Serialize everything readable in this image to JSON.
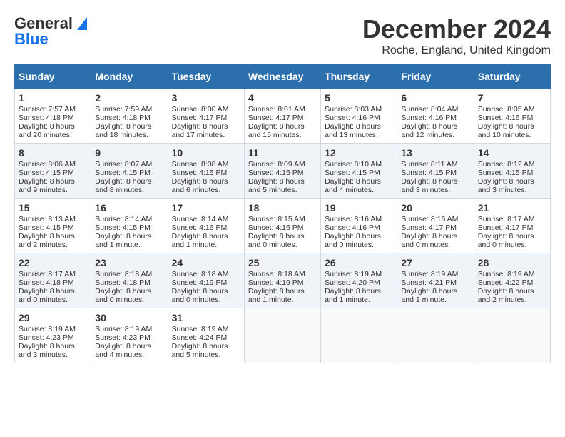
{
  "header": {
    "logo_line1": "General",
    "logo_line2": "Blue",
    "title": "December 2024",
    "subtitle": "Roche, England, United Kingdom"
  },
  "days_of_week": [
    "Sunday",
    "Monday",
    "Tuesday",
    "Wednesday",
    "Thursday",
    "Friday",
    "Saturday"
  ],
  "weeks": [
    [
      {
        "day": 1,
        "sunrise": "7:57 AM",
        "sunset": "4:18 PM",
        "daylight": "8 hours and 20 minutes."
      },
      {
        "day": 2,
        "sunrise": "7:59 AM",
        "sunset": "4:18 PM",
        "daylight": "8 hours and 18 minutes."
      },
      {
        "day": 3,
        "sunrise": "8:00 AM",
        "sunset": "4:17 PM",
        "daylight": "8 hours and 17 minutes."
      },
      {
        "day": 4,
        "sunrise": "8:01 AM",
        "sunset": "4:17 PM",
        "daylight": "8 hours and 15 minutes."
      },
      {
        "day": 5,
        "sunrise": "8:03 AM",
        "sunset": "4:16 PM",
        "daylight": "8 hours and 13 minutes."
      },
      {
        "day": 6,
        "sunrise": "8:04 AM",
        "sunset": "4:16 PM",
        "daylight": "8 hours and 12 minutes."
      },
      {
        "day": 7,
        "sunrise": "8:05 AM",
        "sunset": "4:16 PM",
        "daylight": "8 hours and 10 minutes."
      }
    ],
    [
      {
        "day": 8,
        "sunrise": "8:06 AM",
        "sunset": "4:15 PM",
        "daylight": "8 hours and 9 minutes."
      },
      {
        "day": 9,
        "sunrise": "8:07 AM",
        "sunset": "4:15 PM",
        "daylight": "8 hours and 8 minutes."
      },
      {
        "day": 10,
        "sunrise": "8:08 AM",
        "sunset": "4:15 PM",
        "daylight": "8 hours and 6 minutes."
      },
      {
        "day": 11,
        "sunrise": "8:09 AM",
        "sunset": "4:15 PM",
        "daylight": "8 hours and 5 minutes."
      },
      {
        "day": 12,
        "sunrise": "8:10 AM",
        "sunset": "4:15 PM",
        "daylight": "8 hours and 4 minutes."
      },
      {
        "day": 13,
        "sunrise": "8:11 AM",
        "sunset": "4:15 PM",
        "daylight": "8 hours and 3 minutes."
      },
      {
        "day": 14,
        "sunrise": "8:12 AM",
        "sunset": "4:15 PM",
        "daylight": "8 hours and 3 minutes."
      }
    ],
    [
      {
        "day": 15,
        "sunrise": "8:13 AM",
        "sunset": "4:15 PM",
        "daylight": "8 hours and 2 minutes."
      },
      {
        "day": 16,
        "sunrise": "8:14 AM",
        "sunset": "4:15 PM",
        "daylight": "8 hours and 1 minute."
      },
      {
        "day": 17,
        "sunrise": "8:14 AM",
        "sunset": "4:16 PM",
        "daylight": "8 hours and 1 minute."
      },
      {
        "day": 18,
        "sunrise": "8:15 AM",
        "sunset": "4:16 PM",
        "daylight": "8 hours and 0 minutes."
      },
      {
        "day": 19,
        "sunrise": "8:16 AM",
        "sunset": "4:16 PM",
        "daylight": "8 hours and 0 minutes."
      },
      {
        "day": 20,
        "sunrise": "8:16 AM",
        "sunset": "4:17 PM",
        "daylight": "8 hours and 0 minutes."
      },
      {
        "day": 21,
        "sunrise": "8:17 AM",
        "sunset": "4:17 PM",
        "daylight": "8 hours and 0 minutes."
      }
    ],
    [
      {
        "day": 22,
        "sunrise": "8:17 AM",
        "sunset": "4:18 PM",
        "daylight": "8 hours and 0 minutes."
      },
      {
        "day": 23,
        "sunrise": "8:18 AM",
        "sunset": "4:18 PM",
        "daylight": "8 hours and 0 minutes."
      },
      {
        "day": 24,
        "sunrise": "8:18 AM",
        "sunset": "4:19 PM",
        "daylight": "8 hours and 0 minutes."
      },
      {
        "day": 25,
        "sunrise": "8:18 AM",
        "sunset": "4:19 PM",
        "daylight": "8 hours and 1 minute."
      },
      {
        "day": 26,
        "sunrise": "8:19 AM",
        "sunset": "4:20 PM",
        "daylight": "8 hours and 1 minute."
      },
      {
        "day": 27,
        "sunrise": "8:19 AM",
        "sunset": "4:21 PM",
        "daylight": "8 hours and 1 minute."
      },
      {
        "day": 28,
        "sunrise": "8:19 AM",
        "sunset": "4:22 PM",
        "daylight": "8 hours and 2 minutes."
      }
    ],
    [
      {
        "day": 29,
        "sunrise": "8:19 AM",
        "sunset": "4:23 PM",
        "daylight": "8 hours and 3 minutes."
      },
      {
        "day": 30,
        "sunrise": "8:19 AM",
        "sunset": "4:23 PM",
        "daylight": "8 hours and 4 minutes."
      },
      {
        "day": 31,
        "sunrise": "8:19 AM",
        "sunset": "4:24 PM",
        "daylight": "8 hours and 5 minutes."
      },
      null,
      null,
      null,
      null
    ]
  ],
  "labels": {
    "sunrise": "Sunrise:",
    "sunset": "Sunset:",
    "daylight": "Daylight:"
  }
}
